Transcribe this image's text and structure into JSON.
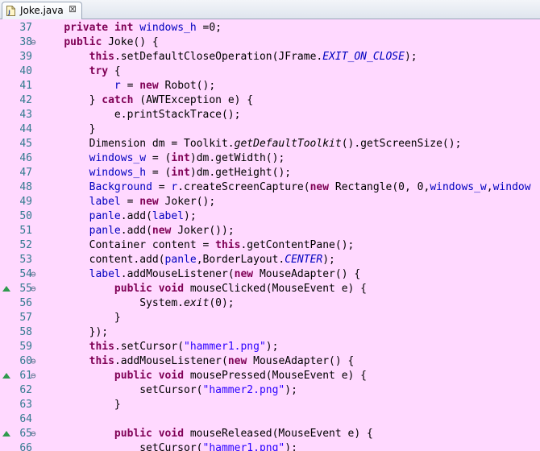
{
  "tab": {
    "title": "Joke.java",
    "close_glyph": "⊠"
  },
  "colors": {
    "editor_bg": "#ffd9ff",
    "keyword": "#7f0055",
    "field": "#0000c0",
    "string": "#2a00ff",
    "line_number": "#337a8f",
    "override_marker": "#2f9a4e"
  },
  "gutter": [
    {
      "n": "37",
      "fold": "",
      "override": false
    },
    {
      "n": "38",
      "fold": "⊖",
      "override": false
    },
    {
      "n": "39",
      "fold": "",
      "override": false
    },
    {
      "n": "40",
      "fold": "",
      "override": false
    },
    {
      "n": "41",
      "fold": "",
      "override": false
    },
    {
      "n": "42",
      "fold": "",
      "override": false
    },
    {
      "n": "43",
      "fold": "",
      "override": false
    },
    {
      "n": "44",
      "fold": "",
      "override": false
    },
    {
      "n": "45",
      "fold": "",
      "override": false
    },
    {
      "n": "46",
      "fold": "",
      "override": false
    },
    {
      "n": "47",
      "fold": "",
      "override": false
    },
    {
      "n": "48",
      "fold": "",
      "override": false
    },
    {
      "n": "49",
      "fold": "",
      "override": false
    },
    {
      "n": "50",
      "fold": "",
      "override": false
    },
    {
      "n": "51",
      "fold": "",
      "override": false
    },
    {
      "n": "52",
      "fold": "",
      "override": false
    },
    {
      "n": "53",
      "fold": "",
      "override": false
    },
    {
      "n": "54",
      "fold": "⊖",
      "override": false
    },
    {
      "n": "55",
      "fold": "⊖",
      "override": true
    },
    {
      "n": "56",
      "fold": "",
      "override": false
    },
    {
      "n": "57",
      "fold": "",
      "override": false
    },
    {
      "n": "58",
      "fold": "",
      "override": false
    },
    {
      "n": "59",
      "fold": "",
      "override": false
    },
    {
      "n": "60",
      "fold": "⊖",
      "override": false
    },
    {
      "n": "61",
      "fold": "⊖",
      "override": true
    },
    {
      "n": "62",
      "fold": "",
      "override": false
    },
    {
      "n": "63",
      "fold": "",
      "override": false
    },
    {
      "n": "64",
      "fold": "",
      "override": false
    },
    {
      "n": "65",
      "fold": "⊖",
      "override": true
    },
    {
      "n": "66",
      "fold": "",
      "override": false
    }
  ],
  "code": [
    [
      [
        "p",
        "    "
      ],
      [
        "k",
        "private"
      ],
      [
        "p",
        " "
      ],
      [
        "k",
        "int"
      ],
      [
        "p",
        " "
      ],
      [
        "f",
        "windows_h"
      ],
      [
        "p",
        " =0;"
      ]
    ],
    [
      [
        "p",
        "    "
      ],
      [
        "k",
        "public"
      ],
      [
        "p",
        " Joke() {"
      ]
    ],
    [
      [
        "p",
        "        "
      ],
      [
        "k",
        "this"
      ],
      [
        "p",
        ".setDefaultCloseOperation(JFrame."
      ],
      [
        "ic",
        "EXIT_ON_CLOSE"
      ],
      [
        "p",
        ");"
      ]
    ],
    [
      [
        "p",
        "        "
      ],
      [
        "k",
        "try"
      ],
      [
        "p",
        " {"
      ]
    ],
    [
      [
        "p",
        "            "
      ],
      [
        "f",
        "r"
      ],
      [
        "p",
        " = "
      ],
      [
        "k",
        "new"
      ],
      [
        "p",
        " Robot();"
      ]
    ],
    [
      [
        "p",
        "        } "
      ],
      [
        "k",
        "catch"
      ],
      [
        "p",
        " (AWTException e) {"
      ]
    ],
    [
      [
        "p",
        "            e.printStackTrace();"
      ]
    ],
    [
      [
        "p",
        "        }"
      ]
    ],
    [
      [
        "p",
        "        Dimension dm = Toolkit."
      ],
      [
        "i",
        "getDefaultToolkit"
      ],
      [
        "p",
        "().getScreenSize();"
      ]
    ],
    [
      [
        "p",
        "        "
      ],
      [
        "f",
        "windows_w"
      ],
      [
        "p",
        " = ("
      ],
      [
        "k",
        "int"
      ],
      [
        "p",
        ")dm.getWidth();"
      ]
    ],
    [
      [
        "p",
        "        "
      ],
      [
        "f",
        "windows_h"
      ],
      [
        "p",
        " = ("
      ],
      [
        "k",
        "int"
      ],
      [
        "p",
        ")dm.getHeight();"
      ]
    ],
    [
      [
        "p",
        "        "
      ],
      [
        "f",
        "Background"
      ],
      [
        "p",
        " = "
      ],
      [
        "f",
        "r"
      ],
      [
        "p",
        ".createScreenCapture("
      ],
      [
        "k",
        "new"
      ],
      [
        "p",
        " Rectangle(0, 0,"
      ],
      [
        "f",
        "windows_w"
      ],
      [
        "p",
        ","
      ],
      [
        "f",
        "window"
      ]
    ],
    [
      [
        "p",
        "        "
      ],
      [
        "f",
        "label"
      ],
      [
        "p",
        " = "
      ],
      [
        "k",
        "new"
      ],
      [
        "p",
        " Joker();"
      ]
    ],
    [
      [
        "p",
        "        "
      ],
      [
        "f",
        "panle"
      ],
      [
        "p",
        ".add("
      ],
      [
        "f",
        "label"
      ],
      [
        "p",
        ");"
      ]
    ],
    [
      [
        "p",
        "        "
      ],
      [
        "f",
        "panle"
      ],
      [
        "p",
        ".add("
      ],
      [
        "k",
        "new"
      ],
      [
        "p",
        " Joker());"
      ]
    ],
    [
      [
        "p",
        "        Container content = "
      ],
      [
        "k",
        "this"
      ],
      [
        "p",
        ".getContentPane();"
      ]
    ],
    [
      [
        "p",
        "        content.add("
      ],
      [
        "f",
        "panle"
      ],
      [
        "p",
        ",BorderLayout."
      ],
      [
        "ic",
        "CENTER"
      ],
      [
        "p",
        ");"
      ]
    ],
    [
      [
        "p",
        "        "
      ],
      [
        "f",
        "label"
      ],
      [
        "p",
        ".addMouseListener("
      ],
      [
        "k",
        "new"
      ],
      [
        "p",
        " MouseAdapter() {"
      ]
    ],
    [
      [
        "p",
        "            "
      ],
      [
        "k",
        "public"
      ],
      [
        "p",
        " "
      ],
      [
        "k",
        "void"
      ],
      [
        "p",
        " mouseClicked(MouseEvent e) {"
      ]
    ],
    [
      [
        "p",
        "                System."
      ],
      [
        "i",
        "exit"
      ],
      [
        "p",
        "(0);"
      ]
    ],
    [
      [
        "p",
        "            }"
      ]
    ],
    [
      [
        "p",
        "        });"
      ]
    ],
    [
      [
        "p",
        "        "
      ],
      [
        "k",
        "this"
      ],
      [
        "p",
        ".setCursor("
      ],
      [
        "s",
        "\"hammer1.png\""
      ],
      [
        "p",
        ");"
      ]
    ],
    [
      [
        "p",
        "        "
      ],
      [
        "k",
        "this"
      ],
      [
        "p",
        ".addMouseListener("
      ],
      [
        "k",
        "new"
      ],
      [
        "p",
        " MouseAdapter() {"
      ]
    ],
    [
      [
        "p",
        "            "
      ],
      [
        "k",
        "public"
      ],
      [
        "p",
        " "
      ],
      [
        "k",
        "void"
      ],
      [
        "p",
        " mousePressed(MouseEvent e) {"
      ]
    ],
    [
      [
        "p",
        "                setCursor("
      ],
      [
        "s",
        "\"hammer2.png\""
      ],
      [
        "p",
        ");"
      ]
    ],
    [
      [
        "p",
        "            }"
      ]
    ],
    [
      [
        "p",
        ""
      ]
    ],
    [
      [
        "p",
        "            "
      ],
      [
        "k",
        "public"
      ],
      [
        "p",
        " "
      ],
      [
        "k",
        "void"
      ],
      [
        "p",
        " mouseReleased(MouseEvent e) {"
      ]
    ],
    [
      [
        "p",
        "                setCursor("
      ],
      [
        "s",
        "\"hammer1.png\""
      ],
      [
        "p",
        ");"
      ]
    ]
  ]
}
